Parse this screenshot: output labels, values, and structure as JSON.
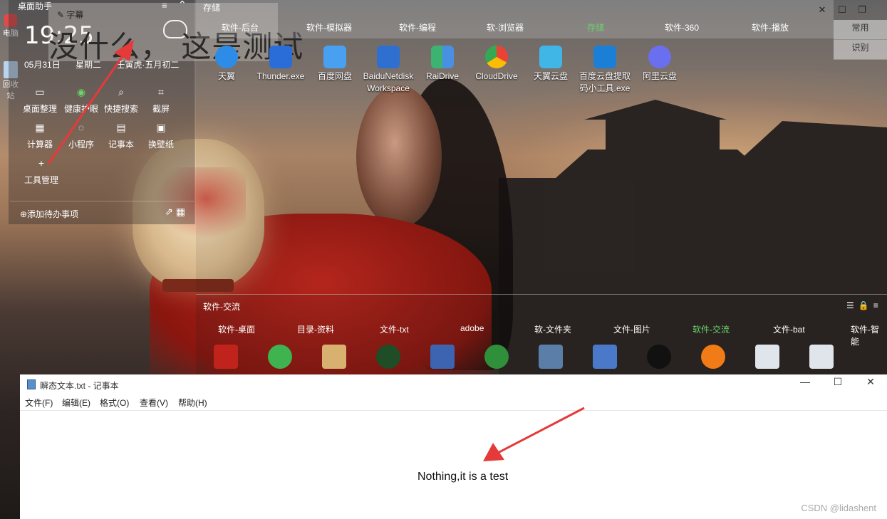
{
  "assistant": {
    "title": "桌面助手",
    "clock": "19:25",
    "date": "05月31日",
    "weekday": "星期二",
    "lunar": "壬寅虎·五月初二",
    "tools": [
      {
        "label": "桌面整理",
        "icon": "monitor-icon"
      },
      {
        "label": "健康护眼",
        "icon": "eye-icon"
      },
      {
        "label": "快捷搜索",
        "icon": "search-icon"
      },
      {
        "label": "截屏",
        "icon": "crop-icon"
      },
      {
        "label": "计算器",
        "icon": "calculator-icon"
      },
      {
        "label": "小程序",
        "icon": "miniapp-icon"
      },
      {
        "label": "记事本",
        "icon": "notebook-icon"
      },
      {
        "label": "换壁纸",
        "icon": "image-icon"
      },
      {
        "label": "工具管理",
        "icon": "plus-icon"
      }
    ],
    "todo": "⊕添加待办事项"
  },
  "subtitle": {
    "title": "字幕",
    "text": "没什么， 这是测试"
  },
  "desktop_edge": {
    "computer": "电脑",
    "recycle": "回收站"
  },
  "fence_top": {
    "title": "存储",
    "tabs": [
      "软件-后台",
      "软件-模拟器",
      "软件-编程",
      "软-浏览器",
      "存储",
      "软件-360",
      "软件-播放"
    ],
    "active_tab": "存储",
    "side_buttons": [
      "常用",
      "识别"
    ],
    "icons": [
      {
        "label": "天翼",
        "color": "#2d8ce8"
      },
      {
        "label": "Thunder.exe",
        "color": "#2a6dd9"
      },
      {
        "label": "百度网盘",
        "color": "#4aa0f0"
      },
      {
        "label": "BaiduNetdiskWorkspace",
        "color": "#2e6fcf"
      },
      {
        "label": "RaiDrive",
        "color": "#3cb371"
      },
      {
        "label": "CloudDrive",
        "color": "#e0a020"
      },
      {
        "label": "天翼云盘",
        "color": "#3fb6e6"
      },
      {
        "label": "百度云盘提取码小工具.exe",
        "color": "#1c7fd6"
      },
      {
        "label": "阿里云盘",
        "color": "#6a6ff0"
      }
    ]
  },
  "fence_bottom": {
    "title": "软件-交流",
    "tabs": [
      "软件-桌面",
      "目录-资料",
      "文件-txt",
      "adobe",
      "软-文件夹",
      "文件-图片",
      "软件-交流",
      "文件-bat",
      "软件-智能"
    ],
    "active_tab": "软件-交流"
  },
  "notepad": {
    "title": "瞬态文本.txt - 记事本",
    "menu": [
      "文件(F)",
      "编辑(E)",
      "格式(O)",
      "查看(V)",
      "帮助(H)"
    ],
    "content": "Nothing,it is a test"
  },
  "watermark": "CSDN @lidashent",
  "colors": {
    "active_tab": "#6ad36a",
    "arrow": "#e53a3a"
  }
}
